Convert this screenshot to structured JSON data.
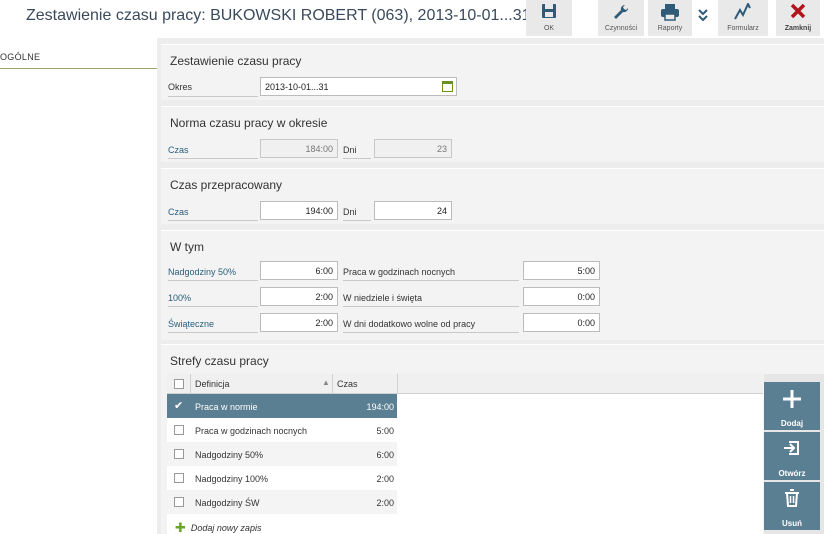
{
  "header": {
    "title": "Zestawienie czasu pracy: BUKOWSKI ROBERT (063), 2013-10-01...31",
    "toolbar": {
      "ok_label": "OK",
      "czynnosci_label": "Czynności",
      "raporty_label": "Raporty",
      "formularz_label": "Formularz",
      "zamknij_label": "Zamknij"
    },
    "colors": {
      "close_red": "#b0151b",
      "icon_blue": "#2f5a78",
      "accent": "#5b7f92"
    }
  },
  "nav": {
    "items": [
      {
        "label": "OGÓLNE"
      }
    ]
  },
  "sections": {
    "zestawienie": {
      "title": "Zestawienie czasu pracy",
      "okres_label": "Okres",
      "okres_value": "2013-10-01...31"
    },
    "norma": {
      "title": "Norma czasu pracy w okresie",
      "czas_label": "Czas",
      "czas_value": "184:00",
      "dni_label": "Dni",
      "dni_value": "23"
    },
    "przepracowany": {
      "title": "Czas przepracowany",
      "czas_label": "Czas",
      "czas_value": "194:00",
      "dni_label": "Dni",
      "dni_value": "24"
    },
    "wtym": {
      "title": "W tym",
      "nadgodziny50_label": "Nadgodziny 50%",
      "nadgodziny50_value": "6:00",
      "p100_label": "100%",
      "p100_value": "2:00",
      "swiateczne_label": "Świąteczne",
      "swiateczne_value": "2:00",
      "nocne_label": "Praca w godzinach nocnych",
      "nocne_value": "5:00",
      "niedziele_label": "W niedziele i święta",
      "niedziele_value": "0:00",
      "wolne_label": "W dni dodatkowo wolne od pracy",
      "wolne_value": "0:00"
    },
    "strefy": {
      "title": "Strefy czasu pracy",
      "col_definicja": "Definicja",
      "col_czas": "Czas",
      "rows": [
        {
          "definicja": "Praca w normie",
          "czas": "194:00",
          "selected": true
        },
        {
          "definicja": "Praca w godzinach nocnych",
          "czas": "5:00"
        },
        {
          "definicja": "Nadgodziny 50%",
          "czas": "6:00"
        },
        {
          "definicja": "Nadgodziny 100%",
          "czas": "2:00"
        },
        {
          "definicja": "Nadgodziny ŚW",
          "czas": "2:00"
        }
      ],
      "add_label": "Dodaj nowy zapis",
      "actions": {
        "dodaj_label": "Dodaj",
        "otworz_label": "Otwórz",
        "usun_label": "Usuń"
      }
    }
  }
}
